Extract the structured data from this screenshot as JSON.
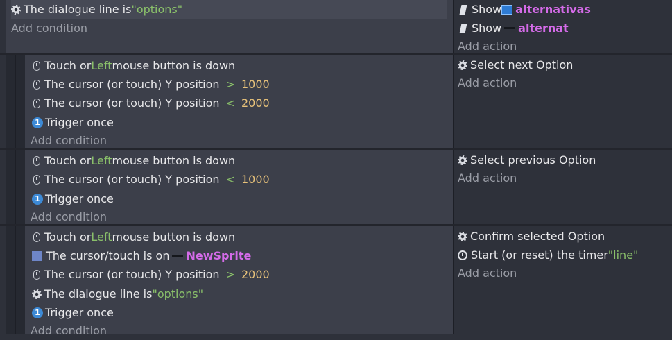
{
  "events": [
    {
      "conditions": [
        {
          "icon": "gear-icon",
          "parts": [
            "The dialogue line is ",
            {
              "str": "\"options\""
            }
          ]
        }
      ],
      "add_condition": "Add condition",
      "actions": [
        {
          "icon": "flag-icon",
          "parts": [
            "Show ",
            {
              "objicon": "object-icon"
            },
            {
              "obj": "alternativas"
            }
          ]
        },
        {
          "icon": "flag-icon",
          "parts": [
            "Show ",
            {
              "objicon": "dash-icon"
            },
            {
              "obj": "alternat"
            }
          ]
        }
      ],
      "add_action": "Add action"
    },
    {
      "conditions": [
        {
          "icon": "mouse-icon",
          "text_a": "Touch or ",
          "kw": "Left",
          "text_b": " mouse button is down"
        },
        {
          "icon": "mouse-icon",
          "text_a": "The cursor (or touch) Y position",
          "op": ">",
          "num": "1000"
        },
        {
          "icon": "mouse-icon",
          "text_a": "The cursor (or touch) Y position",
          "op": "<",
          "num": "2000"
        },
        {
          "icon": "trigger-once-icon",
          "text_a": "Trigger once"
        }
      ],
      "add_condition": "Add condition",
      "actions": [
        {
          "icon": "gear-icon",
          "text": "Select next Option"
        }
      ],
      "add_action": "Add action"
    },
    {
      "conditions": [
        {
          "icon": "mouse-icon",
          "text_a": "Touch or ",
          "kw": "Left",
          "text_b": " mouse button is down"
        },
        {
          "icon": "mouse-icon",
          "text_a": "The cursor (or touch) Y position",
          "op": "<",
          "num": "1000"
        },
        {
          "icon": "trigger-once-icon",
          "text_a": "Trigger once"
        }
      ],
      "add_condition": "Add condition",
      "actions": [
        {
          "icon": "gear-icon",
          "text": "Select previous Option"
        }
      ],
      "add_action": "Add action"
    },
    {
      "conditions": [
        {
          "icon": "mouse-icon",
          "text_a": "Touch or ",
          "kw": "Left",
          "text_b": " mouse button is down"
        },
        {
          "icon": "cursor-on-object-icon",
          "text_a": "The cursor/touch is on ",
          "obj": "NewSprite"
        },
        {
          "icon": "mouse-icon",
          "text_a": "The cursor (or touch) Y position",
          "op": ">",
          "num": "2000"
        },
        {
          "icon": "gear-icon",
          "text_a": "The dialogue line is ",
          "str": "\"options\""
        },
        {
          "icon": "trigger-once-icon",
          "text_a": "Trigger once"
        }
      ],
      "add_condition": "Add condition",
      "actions": [
        {
          "icon": "gear-icon",
          "text": "Confirm selected Option"
        },
        {
          "icon": "timer-icon",
          "text": "Start (or reset) the timer ",
          "str": "\"line\""
        }
      ],
      "add_action": "Add action"
    }
  ],
  "once_glyph": "1"
}
